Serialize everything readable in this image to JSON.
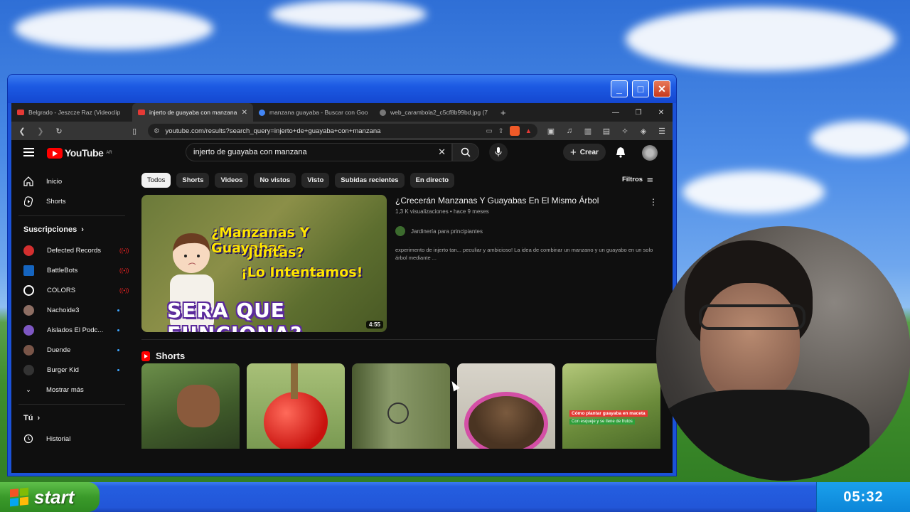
{
  "browser": {
    "tabs": [
      {
        "label": "Belgrado - Jeszcze Raz (Videoclip",
        "color": "#e53935",
        "active": false
      },
      {
        "label": "injerto de guayaba con manzana",
        "color": "#e53935",
        "active": true
      },
      {
        "label": "manzana guayaba - Buscar con Goo",
        "color": "#4285f4",
        "active": false
      },
      {
        "label": "web_carambola2_c5cf8b99bd.jpg (7",
        "color": "#999999",
        "active": false
      }
    ],
    "new_tab": "+",
    "url": "youtube.com/results?search_query=injerto+de+guayaba+con+manzana",
    "brave_badge": "1"
  },
  "youtube": {
    "region": "AR",
    "logo_text": "YouTube",
    "search_value": "injerto de guayaba con manzana",
    "create_label": "Crear",
    "sidebar": {
      "main": [
        {
          "label": "Inicio",
          "icon": "home-icon"
        },
        {
          "label": "Shorts",
          "icon": "shorts-icon"
        }
      ],
      "subs_title": "Suscripciones",
      "subscriptions": [
        {
          "label": "Defected Records",
          "status": "live",
          "color": "#d32f2f"
        },
        {
          "label": "BattleBots",
          "status": "live",
          "color": "#1565c0"
        },
        {
          "label": "COLORS",
          "status": "live",
          "color": "#ffffff"
        },
        {
          "label": "Nachoide3",
          "status": "new",
          "color": "#8d6e63"
        },
        {
          "label": "Aislados El Podc...",
          "status": "new",
          "color": "#7e57c2"
        },
        {
          "label": "Duende",
          "status": "new",
          "color": "#795548"
        },
        {
          "label": "Burger Kid",
          "status": "new",
          "color": "#222222"
        }
      ],
      "show_more": "Mostrar más",
      "you_title": "Tú",
      "history": "Historial"
    },
    "chips": [
      "Todos",
      "Shorts",
      "Videos",
      "No vistos",
      "Visto",
      "Subidas recientes",
      "En directo"
    ],
    "filters_label": "Filtros",
    "video": {
      "thumb_line1": "¿Manzanas Y Guayabas",
      "thumb_line2": "Juntas?",
      "thumb_line3": "¡Lo Intentamos!",
      "thumb_big": "SERA  QUE  FUNCIONA?",
      "duration": "4:55",
      "title": "¿Crecerán Manzanas Y Guayabas En El Mismo Árbol",
      "meta": "1,3 K visualizaciones • hace 9 meses",
      "channel": "Jardinería para principiantes",
      "description": "experimento de injerto tan... peculiar y ambicioso! La idea de combinar un manzano y un guayabo en un solo árbol mediante ..."
    },
    "shorts_title": "Shorts",
    "shorts": [
      {
        "bg": "#4f6e3a",
        "tag": "",
        "tag2": ""
      },
      {
        "bg": "#8fa860",
        "tag": "",
        "tag2": ""
      },
      {
        "bg": "#6a7848",
        "tag": "",
        "tag2": ""
      },
      {
        "bg": "#cfcbc0",
        "tag": "",
        "tag2": ""
      },
      {
        "bg": "#7c9a52",
        "tag": "Cómo plantar guayaba en maceta",
        "tag2": "Con esqueje y se llene de frutos"
      }
    ]
  },
  "taskbar": {
    "start_label": "start",
    "clock": "05:32"
  }
}
